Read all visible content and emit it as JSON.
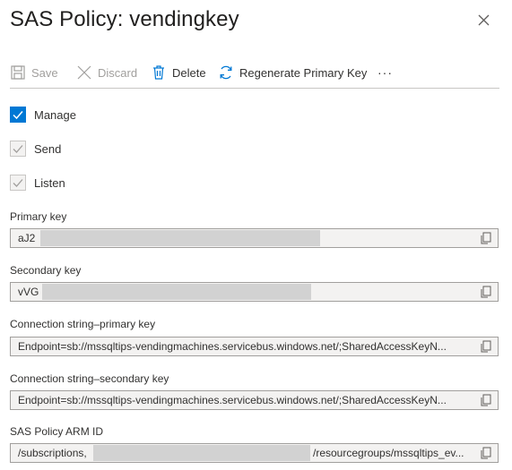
{
  "panel": {
    "title": "SAS Policy: vendingkey"
  },
  "toolbar": {
    "save_label": "Save",
    "discard_label": "Discard",
    "delete_label": "Delete",
    "regenerate_label": "Regenerate Primary Key",
    "more_label": "···"
  },
  "claims": [
    {
      "label": "Manage",
      "checked": true,
      "enabled": true
    },
    {
      "label": "Send",
      "checked": true,
      "enabled": false
    },
    {
      "label": "Listen",
      "checked": true,
      "enabled": false
    }
  ],
  "fields": {
    "primary_key": {
      "label": "Primary key",
      "value": "aJ2"
    },
    "secondary_key": {
      "label": "Secondary key",
      "value": "vVG"
    },
    "conn_primary": {
      "label": "Connection string–primary key",
      "value": "Endpoint=sb://mssqltips-vendingmachines.servicebus.windows.net/;SharedAccessKeyN..."
    },
    "conn_secondary": {
      "label": "Connection string–secondary key",
      "value": "Endpoint=sb://mssqltips-vendingmachines.servicebus.windows.net/;SharedAccessKeyN..."
    },
    "arm_id": {
      "label": "SAS Policy ARM ID",
      "value_prefix": "/subscriptions,",
      "value_suffix": "/resourcegroups/mssqltips_ev..."
    }
  },
  "icons": {
    "save": "save-icon",
    "discard": "discard-icon",
    "delete": "delete-icon",
    "regenerate": "refresh-icon",
    "copy": "copy-icon",
    "close": "close-icon"
  },
  "colors": {
    "accent": "#0078d4",
    "disabled_text": "#a19f9d",
    "field_bg": "#f3f2f1",
    "field_border": "#a19f9d"
  }
}
